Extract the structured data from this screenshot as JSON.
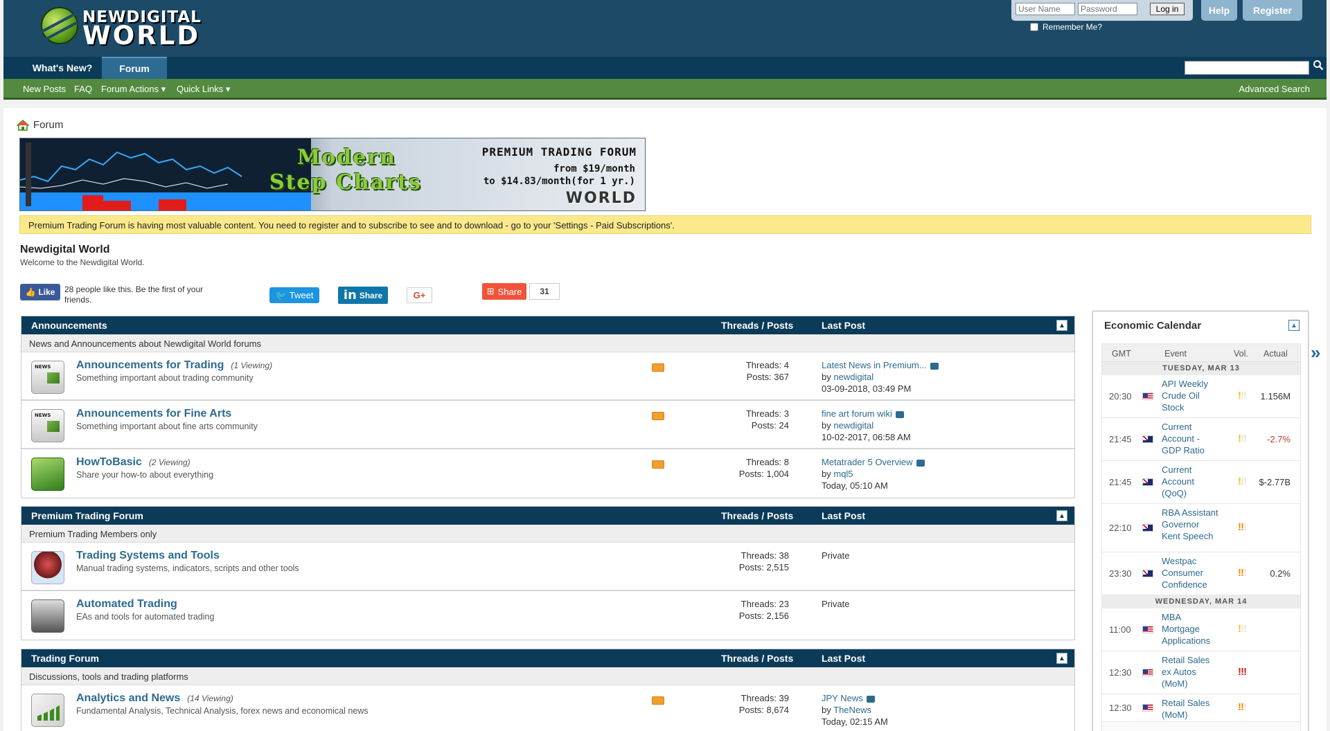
{
  "header": {
    "logo_line1": "NEWDIGITAL",
    "logo_line2": "WORLD",
    "login": {
      "user_placeholder": "User Name",
      "pass_placeholder": "Password",
      "login_label": "Log in",
      "remember_label": "Remember Me?"
    },
    "help_label": "Help",
    "register_label": "Register"
  },
  "nav": {
    "tabs": [
      {
        "label": "What's New?"
      },
      {
        "label": "Forum"
      }
    ]
  },
  "subnav": {
    "items": [
      {
        "label": "New Posts"
      },
      {
        "label": "FAQ"
      },
      {
        "label": "Forum Actions"
      },
      {
        "label": "Quick Links"
      }
    ],
    "advanced_search": "Advanced Search"
  },
  "breadcrumb": {
    "label": "Forum"
  },
  "banner": {
    "line1": "Modern",
    "line2": "Step Charts",
    "premium": "PREMIUM TRADING FORUM",
    "price1": "from $19/month",
    "price2": "to $14.83/month(for 1 yr.)",
    "logo": "WORLD"
  },
  "notice": "Premium Trading Forum is having most valuable content. You need to register and to subscribe to see and to download - go to your 'Settings - Paid Subscriptions'.",
  "site": {
    "title": "Newdigital World",
    "subtitle": "Welcome to the Newdigital World."
  },
  "social": {
    "like_label": "Like",
    "like_text": "28 people like this. Be the first of your friends.",
    "tweet_label": "Tweet",
    "linkedin_label": "Share",
    "gplus_label": "G+",
    "share_label": "Share",
    "share_count": "31"
  },
  "columns": {
    "threads_posts": "Threads / Posts",
    "last_post": "Last Post"
  },
  "sections": [
    {
      "title": "Announcements",
      "description": "News and Announcements about Newdigital World forums",
      "forums": [
        {
          "name": "Announcements for Trading",
          "viewing": "(1 Viewing)",
          "desc": "Something important about trading community",
          "threads": "Threads: 4",
          "posts": "Posts: 367",
          "last_title": "Latest News in Premium...",
          "by": "by",
          "last_user": "newdigital",
          "last_date": "03-09-2018, 03:49 PM"
        },
        {
          "name": "Announcements for Fine Arts",
          "viewing": "",
          "desc": "Something important about fine arts community",
          "threads": "Threads: 3",
          "posts": "Posts: 24",
          "last_title": "fine art forum wiki",
          "by": "by",
          "last_user": "newdigital",
          "last_date": "10-02-2017, 06:58 AM"
        },
        {
          "name": "HowToBasic",
          "viewing": "(2 Viewing)",
          "desc": "Share your how-to about everything",
          "threads": "Threads: 8",
          "posts": "Posts: 1,004",
          "last_title": "Metatrader 5 Overview",
          "by": "by",
          "last_user": "mql5",
          "last_date": "Today, 05:10 AM"
        }
      ]
    },
    {
      "title": "Premium Trading Forum",
      "description": "Premium Trading Members only",
      "forums": [
        {
          "name": "Trading Systems and Tools",
          "viewing": "",
          "desc": "Manual trading systems, indicators, scripts and other tools",
          "threads": "Threads: 38",
          "posts": "Posts: 2,515",
          "last_private": "Private"
        },
        {
          "name": "Automated Trading",
          "viewing": "",
          "desc": "EAs and tools for automated trading",
          "threads": "Threads: 23",
          "posts": "Posts: 2,156",
          "last_private": "Private"
        }
      ]
    },
    {
      "title": "Trading Forum",
      "description": "Discussions, tools and trading platforms",
      "forums": [
        {
          "name": "Analytics and News",
          "viewing": "(14 Viewing)",
          "desc": "Fundamental Analysis, Technical Analysis, forex news and economical news",
          "threads": "Threads: 39",
          "posts": "Posts: 8,674",
          "last_title": "JPY News",
          "by": "by",
          "last_user": "TheNews",
          "last_date": "Today, 02:15 AM"
        }
      ]
    }
  ],
  "calendar": {
    "title": "Economic Calendar",
    "headers": {
      "gmt": "GMT",
      "event": "Event",
      "vol": "Vol.",
      "actual": "Actual"
    },
    "day1": "TUESDAY, MAR 13",
    "day2": "WEDNESDAY, MAR 14",
    "events": [
      {
        "time": "20:30",
        "country": "us-flag-icon",
        "name": "API Weekly Crude Oil Stock",
        "vol": "!!!",
        "level": 1,
        "actual": "1.156M"
      },
      {
        "time": "21:45",
        "country": "au-flag-icon",
        "name": "Current Account - GDP Ratio",
        "vol": "!!!",
        "level": 1,
        "actual": "-2.7%"
      },
      {
        "time": "21:45",
        "country": "au-flag-icon",
        "name": "Current Account (QoQ)",
        "vol": "!!!",
        "level": 1,
        "actual": "$-2.77B"
      },
      {
        "time": "22:10",
        "country": "au-flag-icon",
        "name": "RBA Assistant Governor Kent Speech",
        "vol": "!!!",
        "level": 2,
        "actual": ""
      },
      {
        "time": "23:30",
        "country": "au-flag-icon",
        "name": "Westpac Consumer Confidence",
        "vol": "!!!",
        "level": 2,
        "actual": "0.2%"
      },
      {
        "time": "11:00",
        "country": "us-flag-icon",
        "name": "MBA Mortgage Applications",
        "vol": "!!!",
        "level": 1,
        "actual": ""
      },
      {
        "time": "12:30",
        "country": "us-flag-icon",
        "name": "Retail Sales ex Autos (MoM)",
        "vol": "!!!",
        "level": 3,
        "actual": ""
      },
      {
        "time": "12:30",
        "country": "us-flag-icon",
        "name": "Retail Sales (MoM)",
        "vol": "!!!",
        "level": 2,
        "actual": ""
      }
    ]
  }
}
